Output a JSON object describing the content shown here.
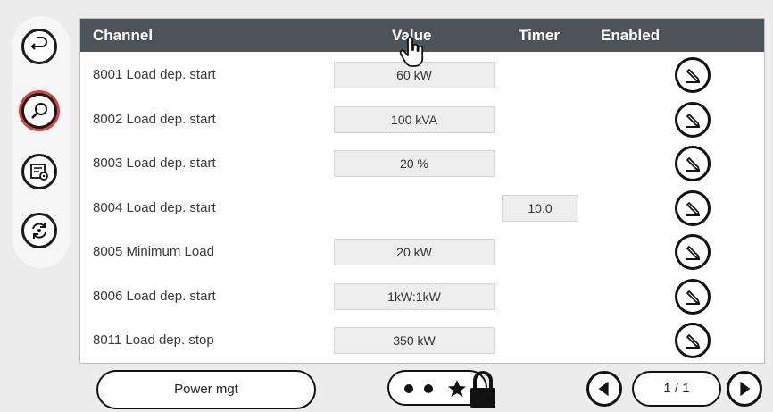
{
  "table": {
    "headers": {
      "channel": "Channel",
      "value": "Value",
      "timer": "Timer",
      "enabled": "Enabled"
    },
    "rows": [
      {
        "channel": "8001 Load dep. start",
        "value": "60 kW",
        "timer": ""
      },
      {
        "channel": "8002 Load dep. start",
        "value": "100 kVA",
        "timer": ""
      },
      {
        "channel": "8003 Load dep. start",
        "value": "20 %",
        "timer": ""
      },
      {
        "channel": "8004 Load dep. start",
        "value": "",
        "timer": "10.0"
      },
      {
        "channel": "8005 Minimum Load",
        "value": "20 kW",
        "timer": ""
      },
      {
        "channel": "8006 Load dep. start",
        "value": "1kW:1kW",
        "timer": ""
      },
      {
        "channel": "8011 Load dep. stop",
        "value": "350 kW",
        "timer": ""
      }
    ]
  },
  "footer": {
    "menu_button": "Power mgt",
    "pager": "1 / 1"
  },
  "icons": {
    "sidebar": [
      "back-icon",
      "search-icon",
      "settings-list-icon",
      "sync-icon"
    ],
    "row_action": "edit-icon",
    "footer": [
      "dots-icon",
      "star-icon",
      "lock-icon",
      "prev-icon",
      "next-icon"
    ]
  },
  "colors": {
    "header_bg": "#4c5359",
    "active_ring": "#d9413f"
  }
}
